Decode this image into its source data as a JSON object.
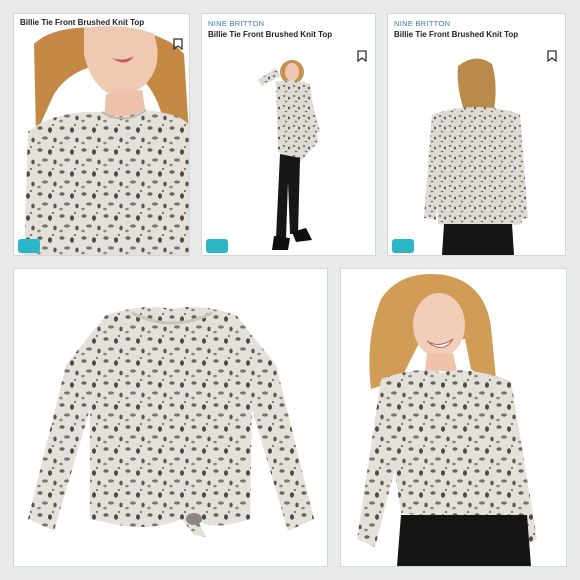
{
  "cards": [
    {
      "brand": "",
      "title": "Billie Tie Front Brushed Knit Top",
      "icon": "bookmark-icon"
    },
    {
      "brand": "NINE BRITTON",
      "title": "Billie Tie Front Brushed Knit Top",
      "icon": "bookmark-icon"
    },
    {
      "brand": "NINE BRITTON",
      "title": "Billie Tie Front Brushed Knit Top",
      "icon": "bookmark-icon"
    }
  ],
  "colors": {
    "brand_blue": "#3b78b5",
    "badge_teal": "#2ab6c4",
    "print_bg": "#e2dfd8",
    "print_spot": "#5f5a55"
  }
}
